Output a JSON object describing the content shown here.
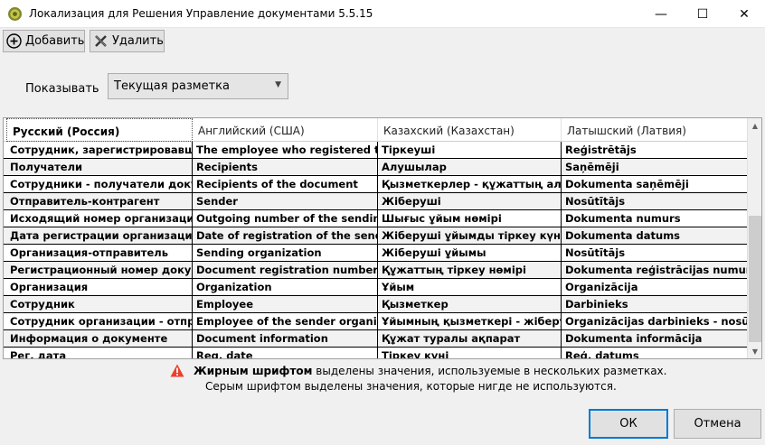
{
  "window": {
    "title": "Локализация для Решения Управление документами 5.5.15",
    "minimize_glyph": "—",
    "maximize_glyph": "☐",
    "close_glyph": "✕"
  },
  "toolbar": {
    "add_label": "Добавить",
    "delete_label": "Удалить"
  },
  "filter": {
    "label": "Показывать",
    "selected": "Текущая разметка"
  },
  "grid": {
    "columns": [
      "Русский (Россия)",
      "Английский (США)",
      "Казахский (Казахстан)",
      "Латышский (Латвия)"
    ],
    "rows": [
      [
        "Сотрудник, зарегистрировавший документ",
        "The employee who registered the document",
        "Тіркеуші",
        "Reģistrētājs"
      ],
      [
        "Получатели",
        "Recipients",
        "Алушылар",
        "Saņēmēji"
      ],
      [
        "Сотрудники - получатели документа",
        "Recipients of the document",
        "Қызметкерлер - құжаттың алушылары",
        "Dokumenta saņēmēji"
      ],
      [
        "Отправитель-контрагент",
        "Sender",
        "Жіберуші",
        "Nosūtītājs"
      ],
      [
        "Исходящий номер организации-отправителя",
        "Outgoing number of the sending organization",
        "Шығыс ұйым нөмірі",
        "Dokumenta numurs"
      ],
      [
        "Дата регистрации организации-отправителя",
        "Date of registration of the sending organization",
        "Жіберуші ұйымды тіркеу күні",
        "Dokumenta datums"
      ],
      [
        "Организация-отправитель",
        "Sending organization",
        "Жіберуші ұйымы",
        "Nosūtītājs"
      ],
      [
        "Регистрационный номер документа",
        "Document registration number",
        "Құжаттың тіркеу нөмірі",
        "Dokumenta reģistrācijas numurs"
      ],
      [
        "Организация",
        "Organization",
        "Ұйым",
        "Organizācija"
      ],
      [
        "Сотрудник",
        "Employee",
        "Қызметкер",
        "Darbinieks"
      ],
      [
        "Сотрудник организации - отправителя",
        "Employee of the sender organization",
        "Ұйымның қызметкері - жіберуші",
        "Organizācijas darbinieks - nosūtītājs"
      ],
      [
        "Информация о документе",
        "Document information",
        "Құжат туралы ақпарат",
        "Dokumenta informācija"
      ],
      [
        "Рег. дата",
        "Reg. date",
        "Тіркеу күні",
        "Reģ. datums"
      ]
    ]
  },
  "notes": {
    "bold_prefix": "Жирным шрифтом",
    "line1_rest": " выделены значения, используемые в нескольких разметках.",
    "line2": "Серым шрифтом выделены значения, которые нигде не используются."
  },
  "buttons": {
    "ok": "ОК",
    "cancel": "Отмена"
  },
  "colors": {
    "accent": "#0078d7",
    "warning": "#e8412c"
  }
}
